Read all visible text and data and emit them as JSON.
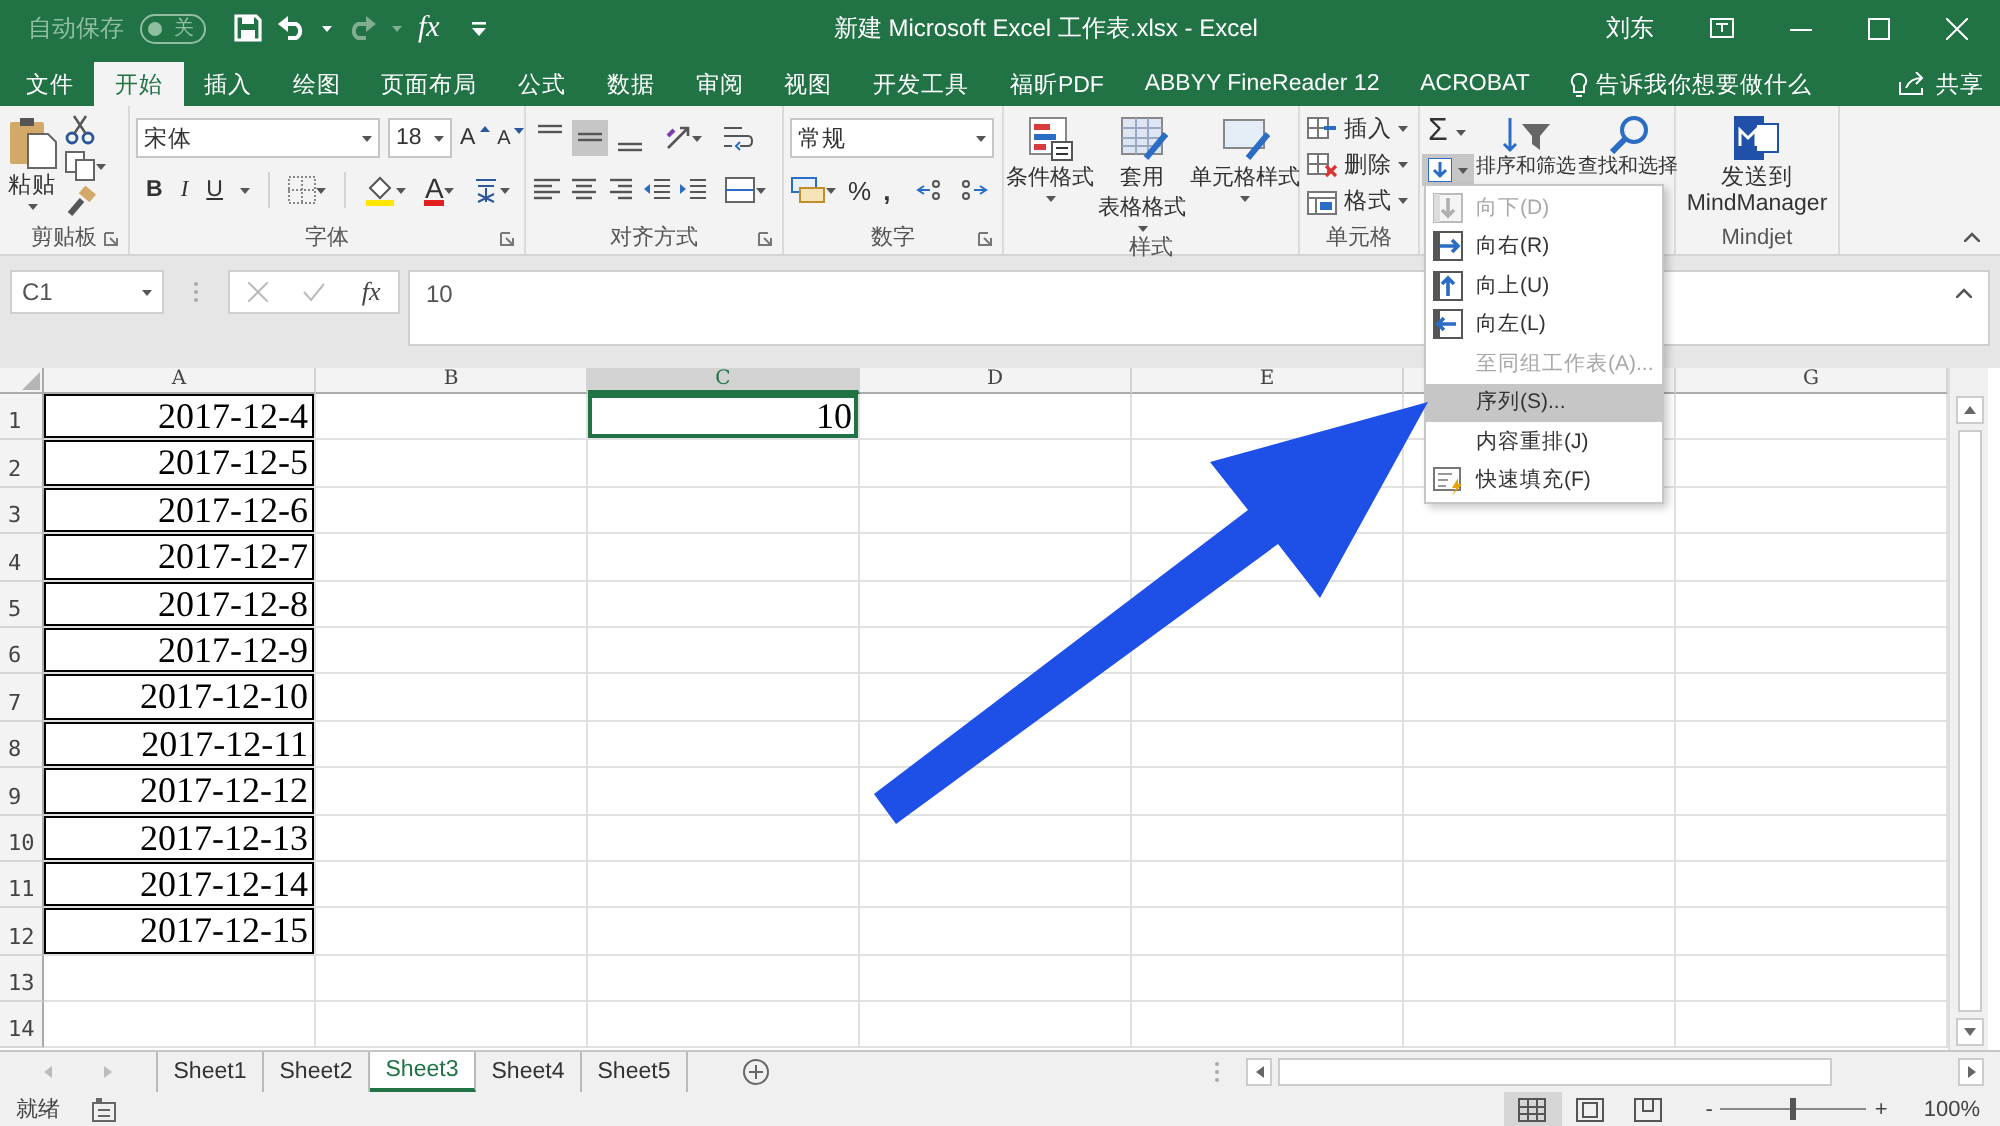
{
  "title_bar": {
    "autosave_label": "自动保存",
    "autosave_toggle": {
      "on": false,
      "label": "关"
    },
    "formula_button": "fx",
    "title": "新建 Microsoft Excel 工作表.xlsx  -  Excel",
    "user": "刘东"
  },
  "tabs": [
    {
      "label": "文件",
      "selected": false
    },
    {
      "label": "开始",
      "selected": true
    },
    {
      "label": "插入",
      "selected": false
    },
    {
      "label": "绘图",
      "selected": false
    },
    {
      "label": "页面布局",
      "selected": false
    },
    {
      "label": "公式",
      "selected": false
    },
    {
      "label": "数据",
      "selected": false
    },
    {
      "label": "审阅",
      "selected": false
    },
    {
      "label": "视图",
      "selected": false
    },
    {
      "label": "开发工具",
      "selected": false
    },
    {
      "label": "福昕PDF",
      "selected": false
    },
    {
      "label": "ABBYY FineReader 12",
      "selected": false
    },
    {
      "label": "ACROBAT",
      "selected": false
    }
  ],
  "tell_me": "告诉我你想要做什么",
  "share": "共享",
  "ribbon": {
    "clipboard": {
      "paste": "粘贴",
      "label": "剪贴板"
    },
    "font": {
      "name": "宋体",
      "size": "18",
      "grow": "A",
      "shrink": "A",
      "bold": "B",
      "italic": "I",
      "underline": "U",
      "font_color_letter": "A",
      "label": "字体"
    },
    "alignment": {
      "vertical": [
        {
          "kind": "top",
          "selected": false
        },
        {
          "kind": "middle",
          "selected": true
        },
        {
          "kind": "bottom",
          "selected": false
        }
      ],
      "label": "对齐方式"
    },
    "number": {
      "format": "常规",
      "percent": "%",
      "comma": ",",
      "label": "数字"
    },
    "styles": {
      "buttons": [
        {
          "kind": "conditional",
          "lines": [
            "条件格式"
          ]
        },
        {
          "kind": "table",
          "lines": [
            "套用",
            "表格格式"
          ]
        },
        {
          "kind": "cell",
          "lines": [
            "单元格样式"
          ]
        }
      ],
      "label": "样式"
    },
    "cells": {
      "buttons": [
        {
          "kind": "insert",
          "label": "插入"
        },
        {
          "kind": "delete",
          "label": "删除"
        },
        {
          "kind": "format",
          "label": "格式"
        }
      ],
      "label": "单元格"
    },
    "editing": {
      "autosum": "Σ",
      "fill_expanded": true,
      "sort": "排序和筛选",
      "find": "查找和选择"
    },
    "mindjet": {
      "button": "发送到\nMindManager",
      "label": "Mindjet"
    }
  },
  "fill_menu": {
    "items": [
      {
        "kind": "down",
        "label": "向下(D)",
        "disabled": true,
        "selected": false
      },
      {
        "kind": "right",
        "label": "向右(R)",
        "disabled": false,
        "selected": false
      },
      {
        "kind": "up",
        "label": "向上(U)",
        "disabled": false,
        "selected": false
      },
      {
        "kind": "left",
        "label": "向左(L)",
        "disabled": false,
        "selected": false
      },
      {
        "kind": "plain",
        "label": "至同组工作表(A)...",
        "disabled": true,
        "selected": false
      },
      {
        "kind": "plain",
        "label": "序列(S)...",
        "disabled": false,
        "selected": true
      },
      {
        "kind": "plain",
        "label": "内容重排(J)",
        "disabled": false,
        "selected": false
      },
      {
        "kind": "flash",
        "label": "快速填充(F)",
        "disabled": false,
        "selected": false
      }
    ]
  },
  "formula_bar": {
    "name_box": "C1",
    "fx": "fx",
    "value": "10"
  },
  "columns": [
    {
      "label": "A",
      "selected": false
    },
    {
      "label": "B",
      "selected": false
    },
    {
      "label": "C",
      "selected": true
    },
    {
      "label": "D",
      "selected": false
    },
    {
      "label": "E",
      "selected": false
    },
    {
      "selected": false
    },
    {
      "label": "G",
      "selected": false
    }
  ],
  "rows": [
    {
      "header": "1",
      "cells": [
        {
          "value": "2017-12-4",
          "bordered": true,
          "selected": false
        },
        null,
        {
          "value": "10",
          "bordered": false,
          "selected": true
        }
      ]
    },
    {
      "header": "2",
      "cells": [
        {
          "value": "2017-12-5",
          "bordered": true,
          "selected": false
        }
      ]
    },
    {
      "header": "3",
      "cells": [
        {
          "value": "2017-12-6",
          "bordered": true,
          "selected": false
        }
      ]
    },
    {
      "header": "4",
      "cells": [
        {
          "value": "2017-12-7",
          "bordered": true,
          "selected": false
        }
      ]
    },
    {
      "header": "5",
      "cells": [
        {
          "value": "2017-12-8",
          "bordered": true,
          "selected": false
        }
      ]
    },
    {
      "header": "6",
      "cells": [
        {
          "value": "2017-12-9",
          "bordered": true,
          "selected": false
        }
      ]
    },
    {
      "header": "7",
      "cells": [
        {
          "value": "2017-12-10",
          "bordered": true,
          "selected": false
        }
      ]
    },
    {
      "header": "8",
      "cells": [
        {
          "value": "2017-12-11",
          "bordered": true,
          "selected": false
        }
      ]
    },
    {
      "header": "9",
      "cells": [
        {
          "value": "2017-12-12",
          "bordered": true,
          "selected": false
        }
      ]
    },
    {
      "header": "10",
      "cells": [
        {
          "value": "2017-12-13",
          "bordered": true,
          "selected": false
        }
      ]
    },
    {
      "header": "11",
      "cells": [
        {
          "value": "2017-12-14",
          "bordered": true,
          "selected": false
        }
      ]
    },
    {
      "header": "12",
      "cells": [
        {
          "value": "2017-12-15",
          "bordered": true,
          "selected": false
        }
      ]
    },
    {
      "header": "13"
    },
    {
      "header": "14"
    }
  ],
  "sheet_tabs": [
    {
      "label": "Sheet1",
      "selected": false
    },
    {
      "label": "Sheet2",
      "selected": false
    },
    {
      "label": "Sheet3",
      "selected": true
    },
    {
      "label": "Sheet4",
      "selected": false
    },
    {
      "label": "Sheet5",
      "selected": false
    }
  ],
  "status_bar": {
    "status": "就绪",
    "views": [
      {
        "kind": "normal",
        "selected": true
      },
      {
        "kind": "page_layout",
        "selected": false
      },
      {
        "kind": "page_break",
        "selected": false
      }
    ],
    "zoom": {
      "minus": "-",
      "plus": "+",
      "level": 0.5,
      "reading": "100%"
    }
  }
}
